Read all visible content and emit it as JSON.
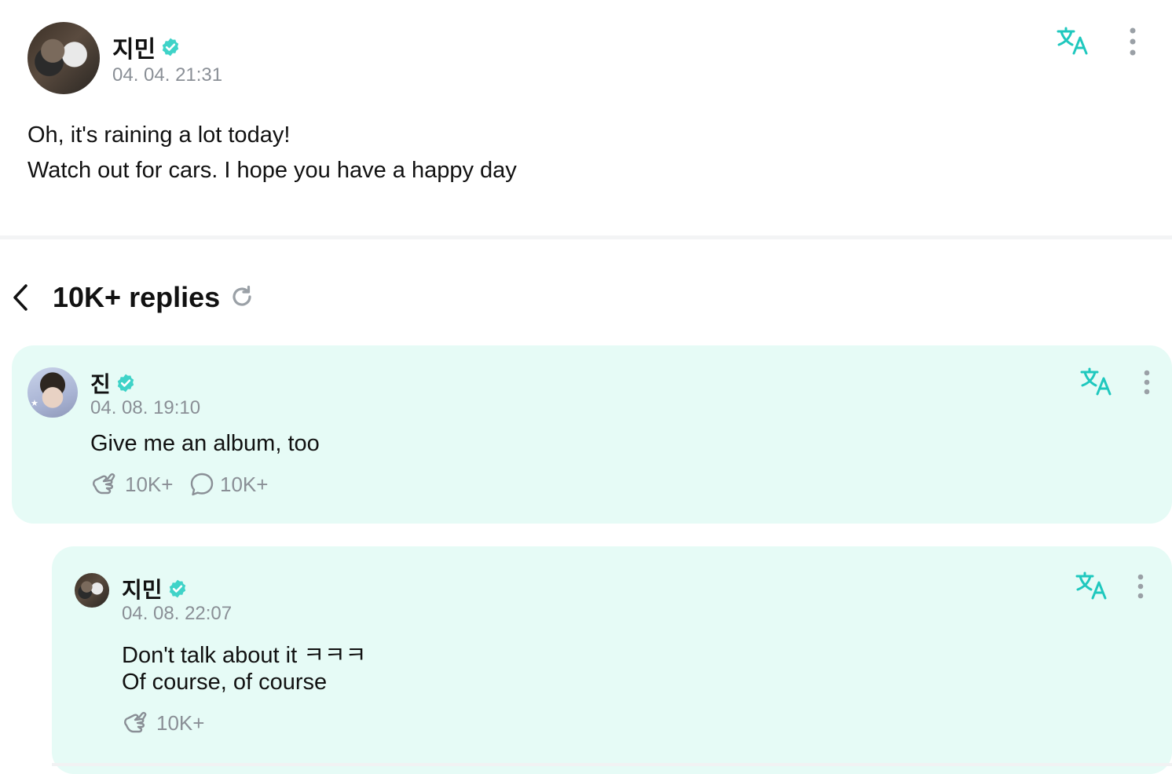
{
  "post": {
    "author": "지민",
    "timestamp": "04. 04. 21:31",
    "line1": "Oh, it's raining a lot today!",
    "line2": "Watch out for cars. I hope you have a happy day"
  },
  "replies_header": {
    "title": "10K+ replies"
  },
  "reply1": {
    "author": "진",
    "timestamp": "04. 08. 19:10",
    "text": "Give me an album, too",
    "likes": "10K+",
    "comments": "10K+"
  },
  "reply2": {
    "author": "지민",
    "timestamp": "04. 08. 22:07",
    "line1": "Don't talk about it ㅋㅋㅋ",
    "line2": "Of course, of course",
    "likes": "10K+"
  },
  "colors": {
    "accent": "#1fc8be",
    "verified": "#3fd3c8",
    "card_bg": "#e6fbf6",
    "muted": "#8a8f96"
  },
  "icons": [
    "translate-icon",
    "more-vertical-icon",
    "verified-badge-icon",
    "back-chevron-icon",
    "refresh-icon",
    "like-hands-icon",
    "comment-bubble-icon"
  ]
}
